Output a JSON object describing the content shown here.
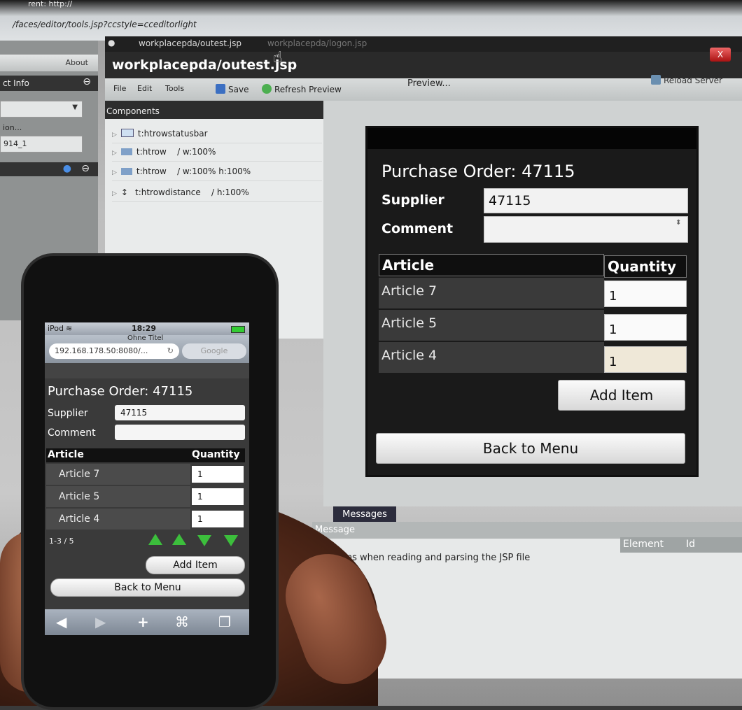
{
  "browser": {
    "url": "/faces/editor/tools.jsp?ccstyle=cceditorlight",
    "header_text": "rent: http://"
  },
  "editor": {
    "tabs": [
      "workplacepda/outest.jsp",
      "workplacepda/logon.jsp"
    ],
    "file_title": "workplacepda/outest.jsp",
    "close_label": "X",
    "menu": {
      "file": "File",
      "edit": "Edit",
      "tools": "Tools"
    },
    "save_label": "Save",
    "refresh_label": "Refresh Preview",
    "preview_label": "Preview...",
    "reload_label": "Reload Server"
  },
  "left_panel": {
    "about": "About",
    "project_info": "ct Info",
    "version_label": "ion...",
    "version_value": "914_1"
  },
  "components": {
    "header": "Components",
    "items": [
      {
        "name": "t:htrowstatusbar",
        "attrs": ""
      },
      {
        "name": "t:htrow",
        "attrs": "/ w:100%"
      },
      {
        "name": "t:htrow",
        "attrs": "/ w:100% h:100%"
      },
      {
        "name": "t:htrowdistance",
        "attrs": "/ h:100%"
      }
    ]
  },
  "preview": {
    "title": "Purchase Order:  47115",
    "supplier_label": "Supplier",
    "supplier_value": "47115",
    "comment_label": "Comment",
    "comment_value": "",
    "col_article": "Article",
    "col_quantity": "Quantity",
    "rows": [
      {
        "article": "Article 7",
        "quantity": "1"
      },
      {
        "article": "Article 5",
        "quantity": "1"
      },
      {
        "article": "Article 4",
        "quantity": "1"
      }
    ],
    "add_item": "Add Item",
    "back_to_menu": "Back to Menu"
  },
  "messages": {
    "tab": "Messages",
    "header": "Message",
    "col_element": "Element",
    "col_id": "Id",
    "text": "Problems when reading and parsing the JSP file"
  },
  "ipod": {
    "carrier": "iPod",
    "time": "18:29",
    "page_title": "Ohne Titel",
    "address": "192.168.178.50:8080/...",
    "search_placeholder": "Google",
    "title": "Purchase Order:  47115",
    "supplier_label": "Supplier",
    "supplier_value": "47115",
    "comment_label": "Comment",
    "col_article": "Article",
    "col_quantity": "Quantity",
    "rows": [
      {
        "article": "Article 7",
        "quantity": "1"
      },
      {
        "article": "Article 5",
        "quantity": "1"
      },
      {
        "article": "Article 4",
        "quantity": "1"
      }
    ],
    "pager": "1-3 / 5",
    "add_item": "Add Item",
    "back_to_menu": "Back to Menu"
  }
}
